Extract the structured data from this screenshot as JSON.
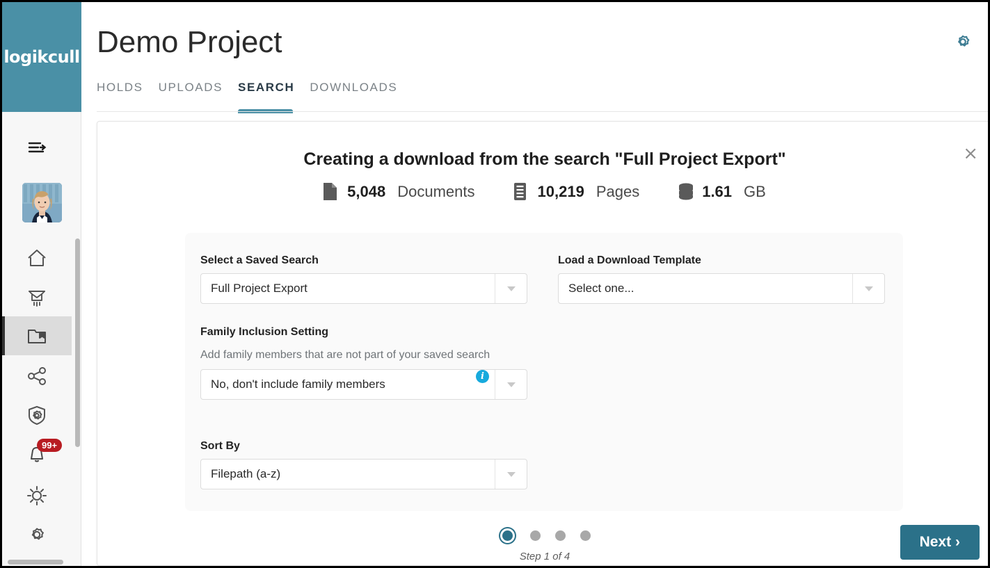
{
  "brand": {
    "logo_text": "logikcull"
  },
  "header": {
    "project_title": "Demo Project",
    "settings_icon": "gear-icon"
  },
  "tabs": [
    {
      "label": "HOLDS",
      "active": false
    },
    {
      "label": "UPLOADS",
      "active": false
    },
    {
      "label": "SEARCH",
      "active": true
    },
    {
      "label": "DOWNLOADS",
      "active": false
    }
  ],
  "sidebar": {
    "items": [
      {
        "icon": "collapse-menu-icon",
        "name": "collapse-menu"
      },
      {
        "icon": "avatar",
        "name": "user-avatar"
      },
      {
        "icon": "home-icon",
        "name": "home"
      },
      {
        "icon": "upload-icon",
        "name": "uploads"
      },
      {
        "icon": "folder-bookmark-icon",
        "name": "projects",
        "active": true
      },
      {
        "icon": "share-icon",
        "name": "share"
      },
      {
        "icon": "shield-gear-icon",
        "name": "admin"
      },
      {
        "icon": "bell-icon",
        "name": "notifications",
        "badge": "99+"
      },
      {
        "icon": "sun-icon",
        "name": "theme"
      },
      {
        "icon": "gear-icon",
        "name": "settings"
      }
    ],
    "notification_badge": "99+"
  },
  "panel": {
    "title": "Creating a download from the search \"Full Project Export\"",
    "close_label": "×",
    "stats": [
      {
        "icon": "document-icon",
        "value": "5,048",
        "unit": "Documents"
      },
      {
        "icon": "pages-icon",
        "value": "10,219",
        "unit": "Pages"
      },
      {
        "icon": "database-icon",
        "value": "1.61",
        "unit": "GB"
      }
    ],
    "fields": {
      "saved_search": {
        "label": "Select a Saved Search",
        "value": "Full Project Export"
      },
      "download_template": {
        "label": "Load a Download Template",
        "value": "Select one..."
      },
      "family_inclusion": {
        "label": "Family Inclusion Setting",
        "help": "Add family members that are not part of your saved search",
        "value": "No, don't include family members",
        "info_glyph": "i"
      },
      "sort_by": {
        "label": "Sort By",
        "value": "Filepath (a-z)"
      }
    },
    "footer": {
      "step_label": "Step 1 of 4",
      "next_label": "Next ›",
      "total_steps": 4,
      "current_step": 1
    }
  },
  "colors": {
    "brand_teal": "#4a90a6",
    "button_teal": "#2b7189",
    "badge_red": "#b81c22",
    "info_cyan": "#17aadd"
  }
}
